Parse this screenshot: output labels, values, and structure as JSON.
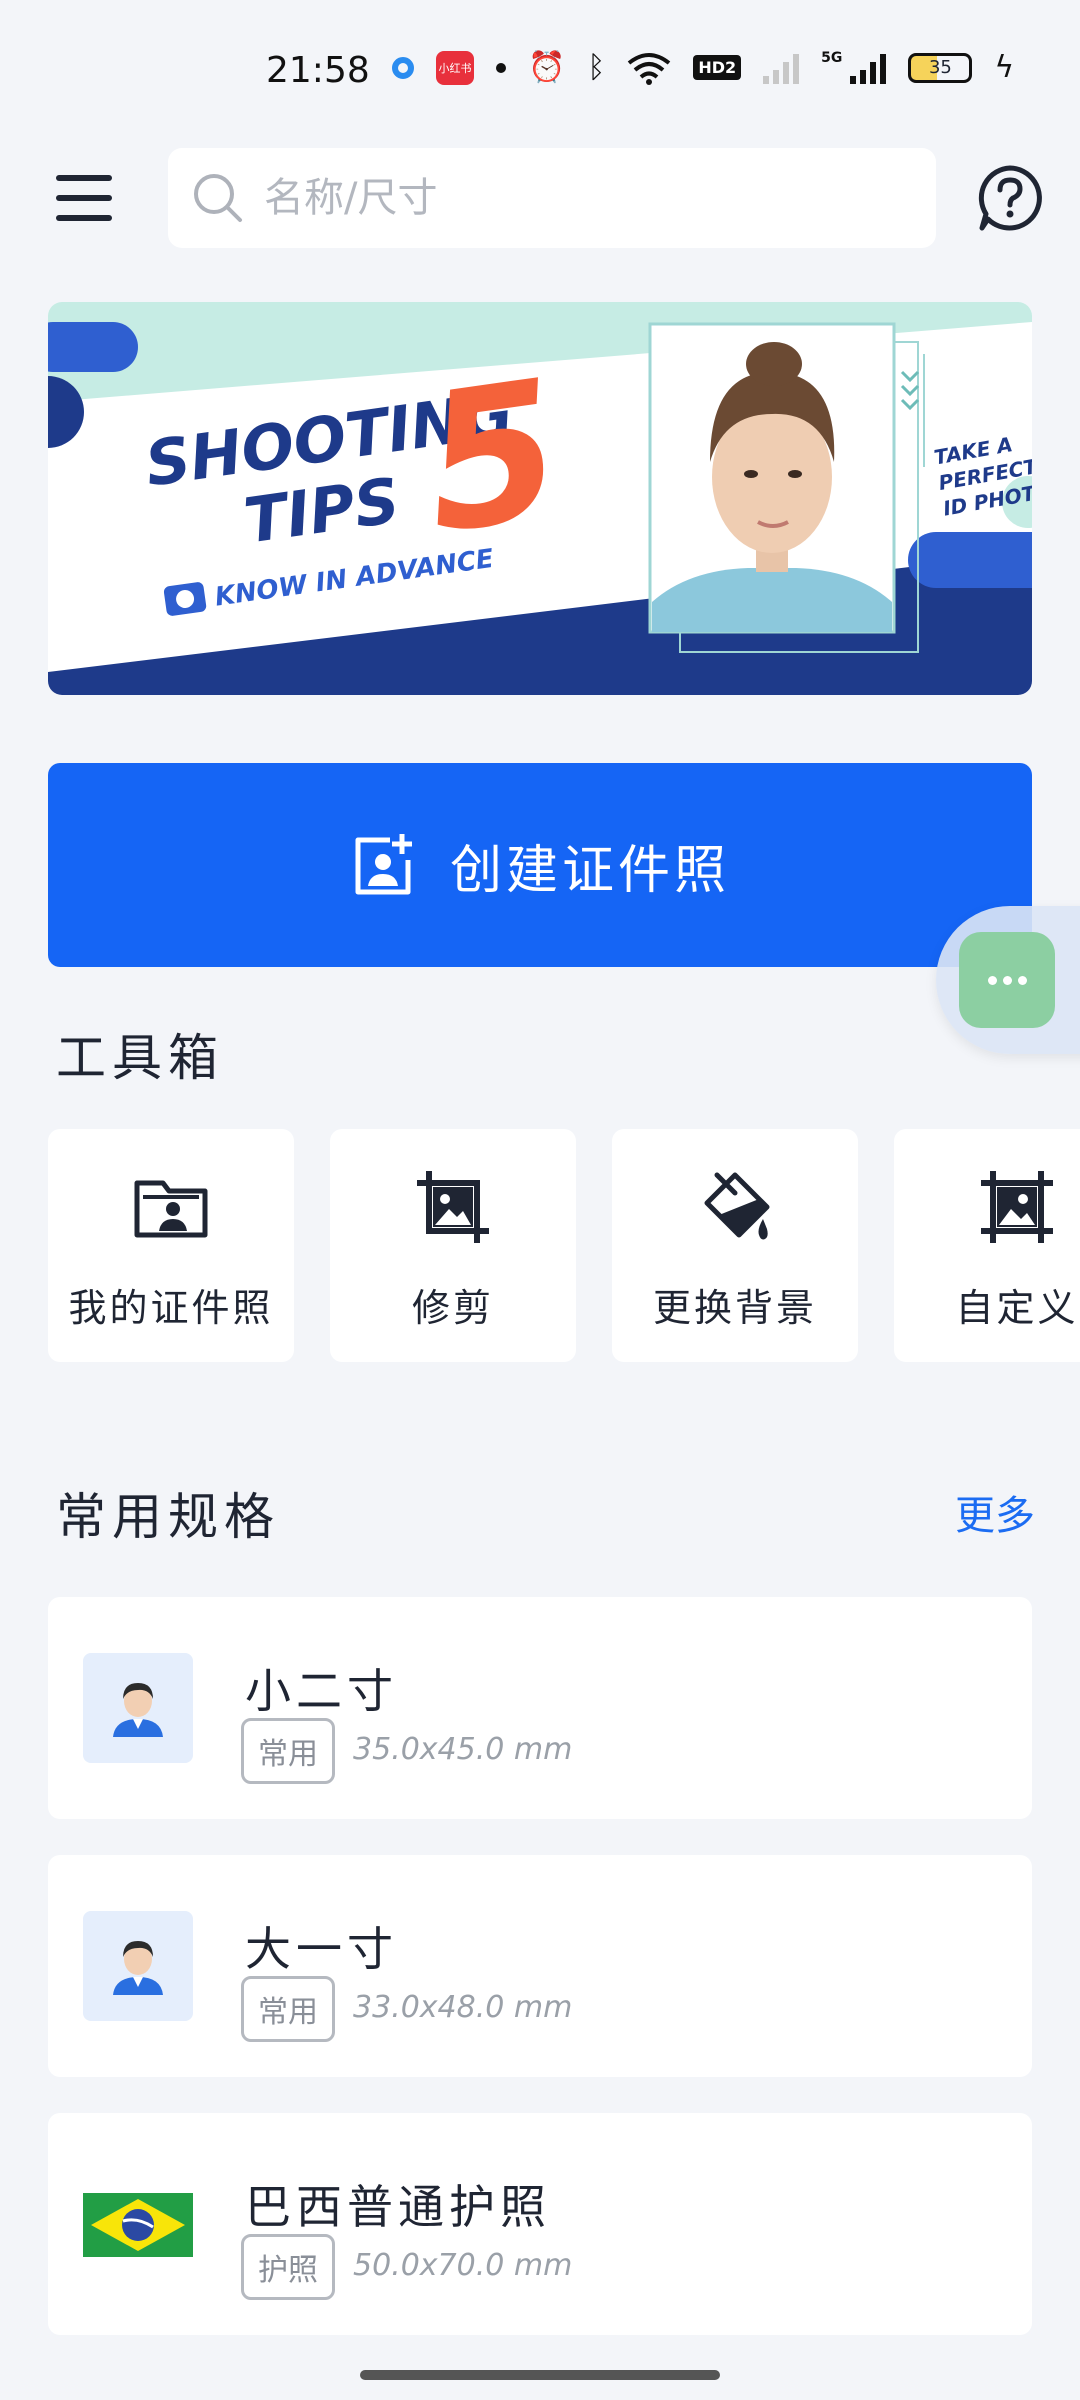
{
  "status_bar": {
    "time": "21:58",
    "app_badge": "小红书",
    "network": "5G",
    "hd": "HD2",
    "battery": "35"
  },
  "search": {
    "placeholder": "名称/尺寸"
  },
  "banner": {
    "line1": "SHOOTING",
    "line2": "TIPS",
    "number": "5",
    "tagline": "KNOW IN ADVANCE",
    "side1": "TAKE A",
    "side2": "PERFECT",
    "side3": "ID PHOTO"
  },
  "create_button": {
    "label": "创建证件照"
  },
  "toolbox": {
    "title": "工具箱",
    "items": [
      {
        "label": "我的证件照",
        "icon": "folder-person-icon"
      },
      {
        "label": "修剪",
        "icon": "crop-icon"
      },
      {
        "label": "更换背景",
        "icon": "paint-bucket-icon"
      },
      {
        "label": "自定义",
        "icon": "custom-frame-icon"
      }
    ]
  },
  "specs": {
    "title": "常用规格",
    "more": "更多",
    "items": [
      {
        "title": "小二寸",
        "tag": "常用",
        "size": "35.0x45.0 mm",
        "thumb": "avatar-icon"
      },
      {
        "title": "大一寸",
        "tag": "常用",
        "size": "33.0x48.0 mm",
        "thumb": "avatar-icon"
      },
      {
        "title": "巴西普通护照",
        "tag": "护照",
        "size": "50.0x70.0 mm",
        "thumb": "brazil-flag-icon"
      }
    ]
  },
  "colors": {
    "primary": "#1565f5",
    "background": "#f3f5f9",
    "banner_navy": "#1e3a8a",
    "banner_orange": "#f4623a",
    "float_green": "#8ccfa2"
  }
}
